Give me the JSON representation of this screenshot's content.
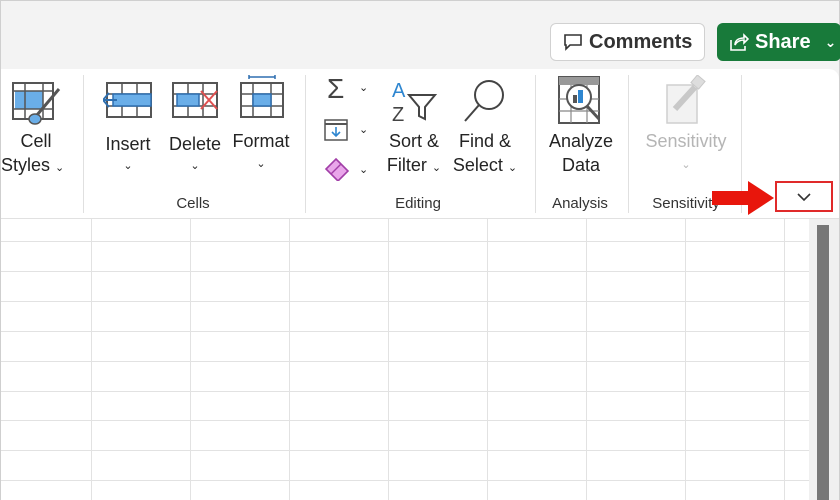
{
  "header": {
    "comments_label": "Comments",
    "share_label": "Share",
    "share_color": "#187a3a"
  },
  "ribbon": {
    "styles": {
      "cell_styles_line1": "Cell",
      "cell_styles_line2": "Styles"
    },
    "cells": {
      "group_label": "Cells",
      "insert_label": "Insert",
      "delete_label": "Delete",
      "format_label": "Format"
    },
    "editing": {
      "group_label": "Editing",
      "autosum_icon": "sigma-icon",
      "fill_icon": "fill-down-icon",
      "clear_icon": "eraser-icon",
      "sort_line1": "Sort &",
      "sort_line2": "Filter",
      "find_line1": "Find &",
      "find_line2": "Select"
    },
    "analysis": {
      "group_label": "Analysis",
      "analyze_line1": "Analyze",
      "analyze_line2": "Data"
    },
    "sensitivity": {
      "group_label": "Sensitivity",
      "button_label": "Sensitivity",
      "disabled": true
    },
    "collapse_icon": "chevron-down-icon"
  },
  "annotation": {
    "arrow_color": "#e8160c",
    "highlight_color": "#e02a2a"
  }
}
